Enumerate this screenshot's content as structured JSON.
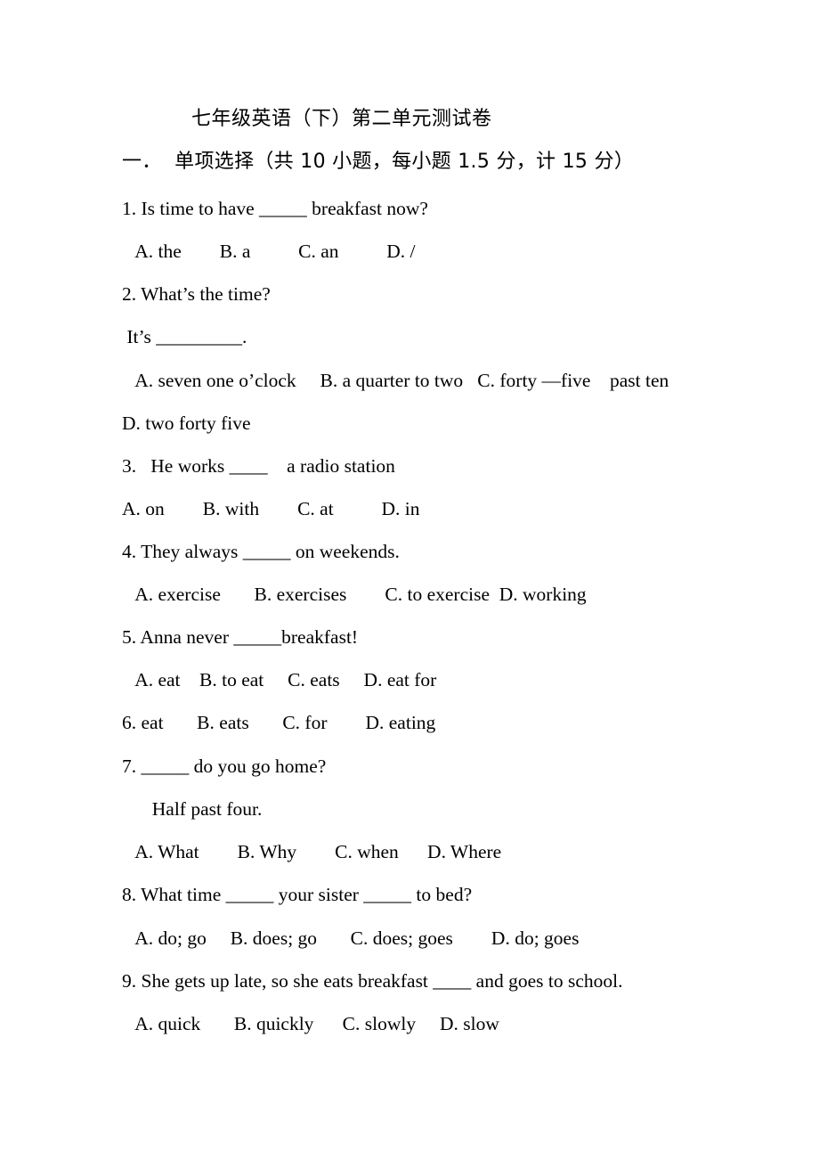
{
  "document": {
    "title": "七年级英语（下）第二单元测试卷",
    "section_heading": "一．  单项选择（共 10 小题，每小题 1.5 分，计 15 分）"
  },
  "questions": [
    {
      "number": "1.",
      "stem": "1. Is time to have _____ breakfast now?",
      "options_line": " A. the        B. a          C. an          D. /"
    },
    {
      "number": "2.",
      "stem": "2. What’s the time?",
      "answer_line": " It’s _________.",
      "options_line": " A. seven one o’clock     B. a quarter to two   C. forty —five    past ten",
      "options_line_2": "D. two forty five"
    },
    {
      "number": "3.",
      "stem": "3.   He works ____    a radio station",
      "options_line": "A. on        B. with        C. at          D. in"
    },
    {
      "number": "4.",
      "stem": "4. They always _____ on weekends.",
      "options_line": " A. exercise       B. exercises        C. to exercise  D. working"
    },
    {
      "number": "5.",
      "stem": "5. Anna never _____breakfast!",
      "options_line": " A. eat    B. to eat     C. eats     D. eat for"
    },
    {
      "number": "6.",
      "stem": "6. eat       B. eats       C. for        D. eating"
    },
    {
      "number": "7.",
      "stem": "7. _____ do you go home?",
      "answer_line": "  Half past four.",
      "options_line": " A. What        B. Why        C. when      D. Where"
    },
    {
      "number": "8.",
      "stem": "8. What time _____ your sister _____ to bed?",
      "options_line": " A. do; go     B. does; go       C. does; goes        D. do; goes"
    },
    {
      "number": "9.",
      "stem": "9. She gets up late, so she eats breakfast ____ and goes to school.",
      "options_line": " A. quick       B. quickly      C. slowly     D. slow"
    }
  ],
  "colors": {
    "page_background": "#ffffff",
    "text": "#000000"
  }
}
